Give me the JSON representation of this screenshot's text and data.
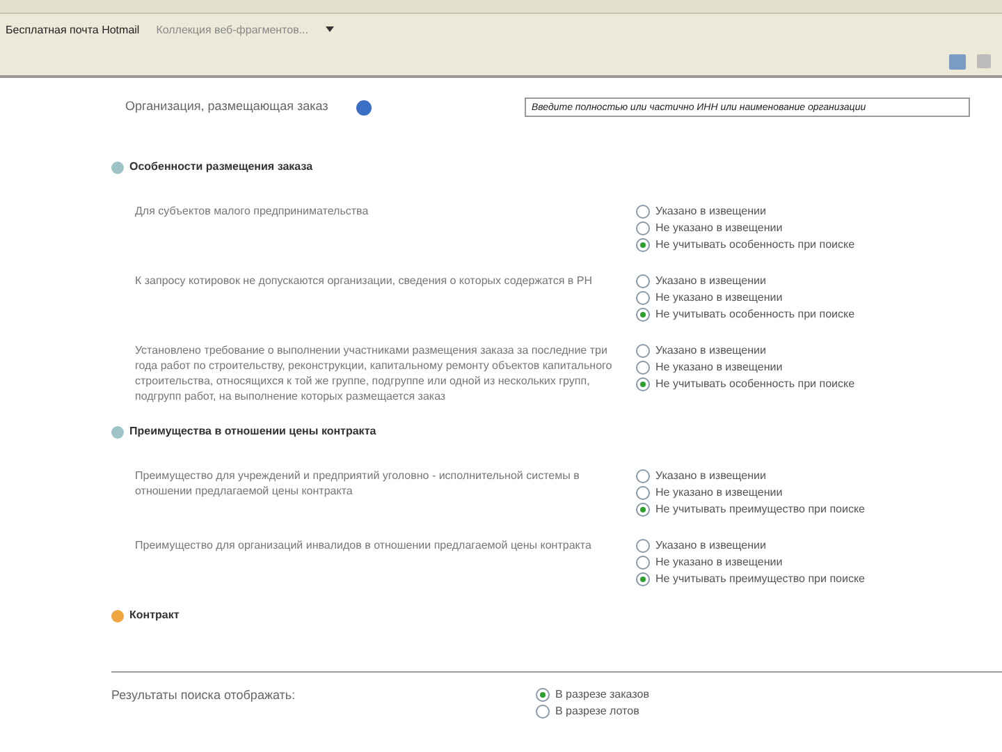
{
  "browser_toolbar": {
    "links": [
      {
        "label": "Бесплатная почта Hotmail"
      },
      {
        "label": "Коллекция веб-фрагментов..."
      }
    ]
  },
  "organization": {
    "label": "Организация, размещающая заказ",
    "placeholder": "Введите полностью или частично ИНН или наименование организации"
  },
  "sections": [
    {
      "title": "Особенности размещения заказа",
      "expanded": true,
      "rows": [
        {
          "label": "Для субъектов малого предпринимательства",
          "options": [
            {
              "label": "Указано в извещении",
              "selected": false
            },
            {
              "label": "Не указано в извещении",
              "selected": false
            },
            {
              "label": "Не учитывать особенность при поиске",
              "selected": true
            }
          ]
        },
        {
          "label": "К запросу котировок не допускаются организации, сведения о которых содержатся в РН",
          "options": [
            {
              "label": "Указано в извещении",
              "selected": false
            },
            {
              "label": "Не указано в извещении",
              "selected": false
            },
            {
              "label": "Не учитывать особенность при поиске",
              "selected": true
            }
          ]
        },
        {
          "label": "Установлено требование о выполнении участниками размещения заказа за последние три года работ по строительству, реконструкции, капитальному ремонту объектов капитального строительства, относящихся к той же группе, подгруппе или одной из нескольких групп, подгрупп работ, на выполнение которых размещается заказ",
          "options": [
            {
              "label": "Указано в извещении",
              "selected": false
            },
            {
              "label": "Не указано в извещении",
              "selected": false
            },
            {
              "label": "Не учитывать особенность при поиске",
              "selected": true
            }
          ]
        }
      ]
    },
    {
      "title": "Преимущества в отношении цены контракта",
      "expanded": true,
      "rows": [
        {
          "label": "Преимущество для учреждений и предприятий уголовно - исполнительной системы в отношении предлагаемой цены контракта",
          "options": [
            {
              "label": "Указано в извещении",
              "selected": false
            },
            {
              "label": "Не указано в извещении",
              "selected": false
            },
            {
              "label": "Не учитывать преимущество при поиске",
              "selected": true
            }
          ]
        },
        {
          "label": "Преимущество для организаций инвалидов в отношении предлагаемой цены контракта",
          "options": [
            {
              "label": "Указано в извещении",
              "selected": false
            },
            {
              "label": "Не указано в извещении",
              "selected": false
            },
            {
              "label": "Не учитывать преимущество при поиске",
              "selected": true
            }
          ]
        }
      ]
    },
    {
      "title": "Контракт",
      "expanded": false
    }
  ],
  "results_display": {
    "label": "Результаты поиска отображать:",
    "options": [
      {
        "label": "В разрезе заказов",
        "selected": true
      },
      {
        "label": "В разрезе лотов",
        "selected": false
      }
    ]
  }
}
